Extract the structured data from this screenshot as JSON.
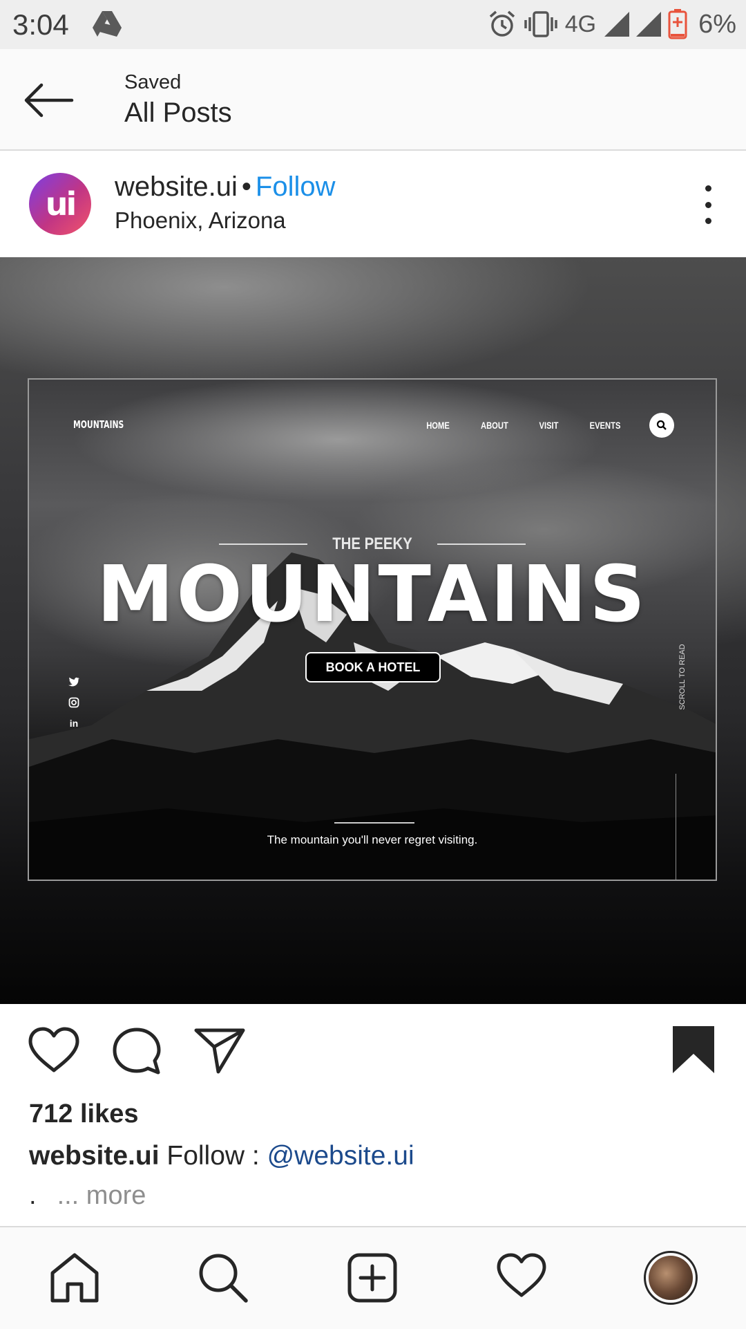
{
  "status_bar": {
    "time": "3:04",
    "network": "4G",
    "battery": "6%",
    "battery_color": "#e8533c",
    "icons": [
      "drive-icon",
      "alarm-icon",
      "vibrate-icon",
      "signal-icon",
      "signal-icon",
      "battery-icon"
    ]
  },
  "header": {
    "subtitle": "Saved",
    "title": "All Posts"
  },
  "post": {
    "avatar_text": "ui",
    "username": "website.ui",
    "separator": "•",
    "follow_label": "Follow",
    "location": "Phoenix, Arizona",
    "image": {
      "logo": "MOUNTAINS",
      "nav": [
        "HOME",
        "ABOUT",
        "VISIT",
        "EVENTS"
      ],
      "pre_title": "THE PEEKY",
      "title": "MOUNTAINS",
      "button": "BOOK A HOTEL",
      "social": [
        "twitter-icon",
        "instagram-icon",
        "linkedin-icon"
      ],
      "linkedin_text": "in",
      "scroll_label": "SCROLL TO READ",
      "tagline": "The mountain you'll never regret visiting."
    },
    "likes": "712 likes",
    "caption": {
      "username": "website.ui",
      "text": " Follow : ",
      "mention": "@website.ui"
    },
    "more_dot": ".",
    "more_label": "... more"
  },
  "colors": {
    "follow": "#1b8fe8",
    "mention": "#1c4a8c",
    "text": "#262626",
    "muted": "#8e8e8e"
  },
  "bottom_nav": [
    "home-icon",
    "search-icon",
    "add-post-icon",
    "activity-heart-icon",
    "profile-avatar"
  ]
}
